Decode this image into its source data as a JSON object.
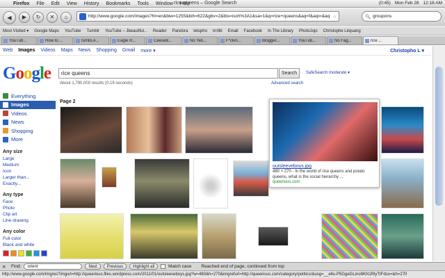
{
  "menubar": {
    "app": "Firefox",
    "items": [
      "File",
      "Edit",
      "View",
      "History",
      "Bookmarks",
      "Tools",
      "Window",
      "Help"
    ],
    "window_title": "rice queens – Google Search",
    "status": {
      "battery": "(0:45)",
      "date": "Mon Feb 28",
      "time": "12:16 AM"
    }
  },
  "toolbar": {
    "url": "http://www.google.com/images?hl=en&biw=1255&bih=622&gbv=2&tbs=isch%3A1&sa=1&q=rice+queens&aq=f&aqi=&aq=",
    "search_engine_query": "groupons"
  },
  "bookmarks": [
    "Most Visited ▾",
    "Google Maps",
    "YouTube",
    "Tumblr",
    "YouTube – Jbeautiful...",
    "Reader",
    "Pandora",
    "letopho",
    "trrrlbl",
    "Email",
    "Facebook",
    "In The Library",
    "PhotoJojo",
    "Christophe Léquang"
  ],
  "tabs": [
    "YouTub...",
    "How to ...",
    "tumbLA...",
    "Eagle R...",
    "CeeseB...",
    "No Yell...",
    "F*ckin...",
    "Blogger...",
    "YouTub...",
    "No Fag...",
    "rice ..."
  ],
  "gbar": {
    "links": [
      "Web",
      "Images",
      "Videos",
      "Maps",
      "News",
      "Shopping",
      "Gmail",
      "more ▾"
    ],
    "user": "Christopho L ▾"
  },
  "logo": [
    "G",
    "o",
    "o",
    "g",
    "l",
    "e"
  ],
  "search": {
    "query": "rice queens",
    "button": "Search",
    "safesearch": "SafeSearch moderate ▾",
    "results": "About 1,790,000 results (0.19 seconds)",
    "advanced": "Advanced search"
  },
  "leftnav": {
    "items": [
      {
        "label": "Everything",
        "color": "#3c8e3c"
      },
      {
        "label": "Images",
        "color": "#ffffff"
      },
      {
        "label": "Videos",
        "color": "#b5463a"
      },
      {
        "label": "News",
        "color": "#2b62c8"
      },
      {
        "label": "Shopping",
        "color": "#e59b2c"
      },
      {
        "label": "More",
        "color": "#2b62c8"
      }
    ],
    "size_head": "Any size",
    "sizes": [
      "Large",
      "Medium",
      "Icon",
      "Larger than...",
      "Exactly..."
    ],
    "type_head": "Any type",
    "types": [
      "Face",
      "Photo",
      "Clip art",
      "Line drawing"
    ],
    "color_head": "Any color",
    "colors": [
      "Full color",
      "Black and white"
    ],
    "swatch_colors": [
      "#e02020",
      "#f08a1a",
      "#f2e21a",
      "#3bb23b",
      "#1a9ad8",
      "#2a3fd8",
      "#9a2ad8",
      "#e85cb0",
      "#ffffff",
      "#8a8a8a",
      "#000000",
      "#7a4a1a"
    ]
  },
  "page_label": "Page 2",
  "hover": {
    "filename": "outsleeveboys.jpg",
    "desc": "480 × 270 - In the world of rice queens and potato queens, what is the social hierarchy ...",
    "site": "queerious.com"
  },
  "findbar": {
    "label": "Find:",
    "value": "orient",
    "next": "Next",
    "previous": "Previous",
    "highlight": "Highlight all",
    "match_case": "Match case",
    "status": "Reached end of page, continued from top"
  },
  "statusbar": "http://www.google.com/imgres?imgurl=http://queerious.files.wordpress.com/2011/01/outsleeveboys.jpg?w=480&h=270&imgrefurl=http://queerious.com/category/politics/&usg=__e6s-P5GgeGLino9KN1RlyTtFdso=&h=270"
}
